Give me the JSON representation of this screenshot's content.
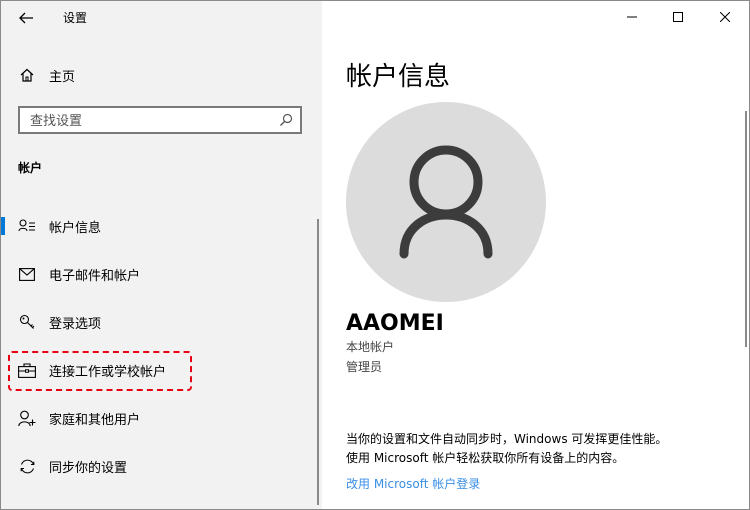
{
  "window": {
    "title": "设置",
    "controls": {
      "minimize": "minimize-icon",
      "maximize": "maximize-icon",
      "close": "close-icon"
    }
  },
  "sidebar": {
    "home_label": "主页",
    "search": {
      "placeholder": "查找设置",
      "value": ""
    },
    "section_title": "帐户",
    "items": [
      {
        "label": "帐户信息",
        "icon": "person-card-icon",
        "active": true
      },
      {
        "label": "电子邮件和帐户",
        "icon": "mail-icon"
      },
      {
        "label": "登录选项",
        "icon": "key-icon"
      },
      {
        "label": "连接工作或学校帐户",
        "icon": "briefcase-icon",
        "highlighted": true
      },
      {
        "label": "家庭和其他用户",
        "icon": "add-person-icon"
      },
      {
        "label": "同步你的设置",
        "icon": "sync-icon"
      }
    ]
  },
  "main": {
    "title": "帐户信息",
    "user": {
      "name": "AAOMEI",
      "account_type": "本地帐户",
      "role": "管理员"
    },
    "info_line1": "当你的设置和文件自动同步时，Windows 可发挥更佳性能。",
    "info_line2": "使用 Microsoft 帐户轻松获取你所有设备上的内容。",
    "link": "改用 Microsoft 帐户登录"
  },
  "colors": {
    "accent": "#0078d7",
    "highlight_border": "#e60012",
    "link": "#3a8ee6",
    "avatar_bg": "#dcdcdc",
    "avatar_fg": "#3c3c3c"
  }
}
